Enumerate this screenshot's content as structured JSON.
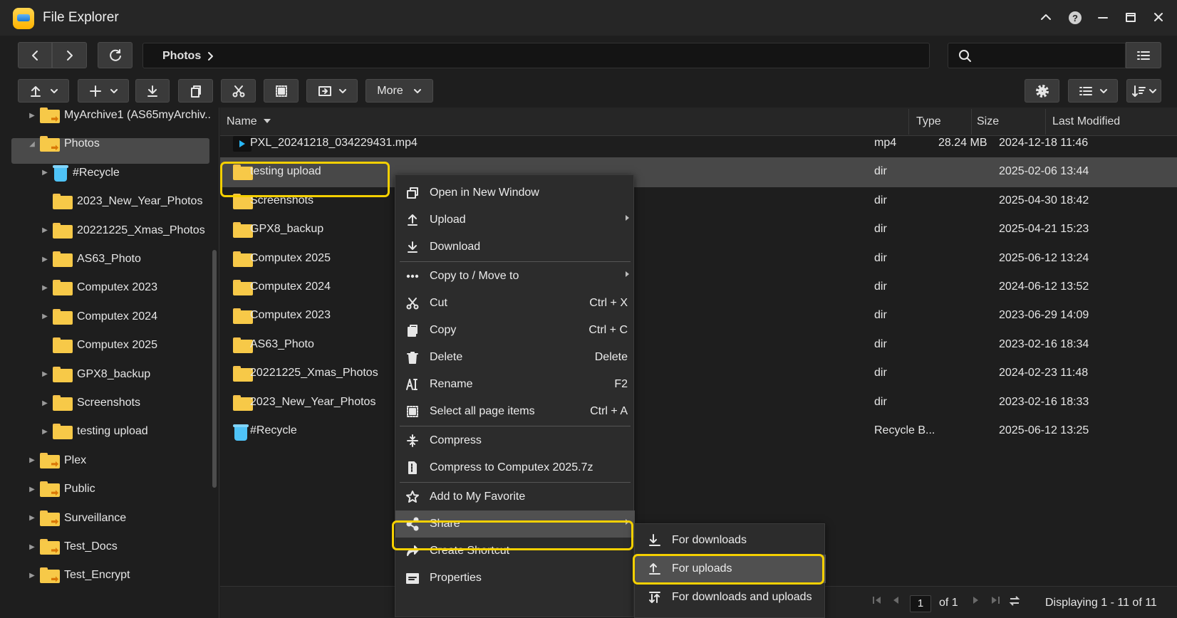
{
  "window": {
    "title": "File Explorer"
  },
  "toolbar": {
    "path": "Photos",
    "more_label": "More",
    "search_placeholder": ""
  },
  "sidebar": {
    "items": [
      {
        "label": "MyArchive1 (AS65myArchiv..",
        "icon": "share-folder-icon",
        "level": 0,
        "expand": "collapsed"
      },
      {
        "label": "Photos",
        "icon": "share-folder-icon",
        "level": 0,
        "expand": "expanded",
        "selected": true
      },
      {
        "label": "#Recycle",
        "icon": "recycle-bin-icon",
        "level": 1,
        "expand": "collapsed"
      },
      {
        "label": "2023_New_Year_Photos",
        "icon": "folder-icon",
        "level": 1,
        "expand": "none"
      },
      {
        "label": "20221225_Xmas_Photos",
        "icon": "folder-icon",
        "level": 1,
        "expand": "collapsed"
      },
      {
        "label": "AS63_Photo",
        "icon": "folder-icon",
        "level": 1,
        "expand": "collapsed"
      },
      {
        "label": "Computex 2023",
        "icon": "folder-icon",
        "level": 1,
        "expand": "collapsed"
      },
      {
        "label": "Computex 2024",
        "icon": "folder-icon",
        "level": 1,
        "expand": "collapsed"
      },
      {
        "label": "Computex 2025",
        "icon": "folder-icon",
        "level": 1,
        "expand": "none"
      },
      {
        "label": "GPX8_backup",
        "icon": "folder-icon",
        "level": 1,
        "expand": "collapsed"
      },
      {
        "label": "Screenshots",
        "icon": "folder-icon",
        "level": 1,
        "expand": "collapsed"
      },
      {
        "label": "testing upload",
        "icon": "folder-icon",
        "level": 1,
        "expand": "collapsed"
      },
      {
        "label": "Plex",
        "icon": "share-folder-icon",
        "level": 0,
        "expand": "collapsed"
      },
      {
        "label": "Public",
        "icon": "share-folder-icon",
        "level": 0,
        "expand": "collapsed"
      },
      {
        "label": "Surveillance",
        "icon": "share-folder-icon",
        "level": 0,
        "expand": "collapsed"
      },
      {
        "label": "Test_Docs",
        "icon": "share-folder-icon",
        "level": 0,
        "expand": "collapsed"
      },
      {
        "label": "Test_Encrypt",
        "icon": "share-folder-icon",
        "level": 0,
        "expand": "collapsed"
      }
    ]
  },
  "table": {
    "columns": [
      "Name",
      "Type",
      "Size",
      "Last Modified"
    ],
    "rows": [
      {
        "name": "PXL_20241218_034229431.mp4",
        "type": "mp4",
        "size": "28.24 MB",
        "modified": "2024-12-18 11:46",
        "icon": "video-icon"
      },
      {
        "name": "testing upload",
        "type": "dir",
        "size": "",
        "modified": "2025-02-06 13:44",
        "icon": "folder-icon",
        "selected": true
      },
      {
        "name": "Screenshots",
        "type": "dir",
        "size": "",
        "modified": "2025-04-30 18:42",
        "icon": "folder-icon"
      },
      {
        "name": "GPX8_backup",
        "type": "dir",
        "size": "",
        "modified": "2025-04-21 15:23",
        "icon": "folder-icon"
      },
      {
        "name": "Computex 2025",
        "type": "dir",
        "size": "",
        "modified": "2025-06-12 13:24",
        "icon": "folder-icon"
      },
      {
        "name": "Computex 2024",
        "type": "dir",
        "size": "",
        "modified": "2024-06-12 13:52",
        "icon": "folder-icon"
      },
      {
        "name": "Computex 2023",
        "type": "dir",
        "size": "",
        "modified": "2023-06-29 14:09",
        "icon": "folder-icon"
      },
      {
        "name": "AS63_Photo",
        "type": "dir",
        "size": "",
        "modified": "2023-02-16 18:34",
        "icon": "folder-icon"
      },
      {
        "name": "20221225_Xmas_Photos",
        "type": "dir",
        "size": "",
        "modified": "2024-02-23 11:48",
        "icon": "folder-icon"
      },
      {
        "name": "2023_New_Year_Photos",
        "type": "dir",
        "size": "",
        "modified": "2023-02-16 18:33",
        "icon": "folder-icon"
      },
      {
        "name": "#Recycle",
        "type": "Recycle B...",
        "size": "",
        "modified": "2025-06-12 13:25",
        "icon": "recycle-bin-icon"
      }
    ]
  },
  "pagination": {
    "page": "1",
    "of_label": "of 1",
    "display": "Displaying 1 - 11 of 11"
  },
  "context_menu": {
    "items": [
      {
        "label": "Open in New Window",
        "shortcut": "",
        "icon": "new-window-icon",
        "submenu": false
      },
      {
        "label": "Upload",
        "shortcut": "",
        "icon": "upload-icon",
        "submenu": true
      },
      {
        "label": "Download",
        "shortcut": "",
        "icon": "download-icon",
        "submenu": false
      },
      {
        "label": "Copy to / Move to",
        "shortcut": "",
        "icon": "more-dots-icon",
        "submenu": true
      },
      {
        "label": "Cut",
        "shortcut": "Ctrl + X",
        "icon": "scissors-icon",
        "submenu": false
      },
      {
        "label": "Copy",
        "shortcut": "Ctrl + C",
        "icon": "copy-icon",
        "submenu": false
      },
      {
        "label": "Delete",
        "shortcut": "Delete",
        "icon": "trash-icon",
        "submenu": false
      },
      {
        "label": "Rename",
        "shortcut": "F2",
        "icon": "rename-icon",
        "submenu": false
      },
      {
        "label": "Select all page items",
        "shortcut": "Ctrl + A",
        "icon": "select-all-icon",
        "submenu": false
      },
      {
        "label": "Compress",
        "shortcut": "",
        "icon": "compress-icon",
        "submenu": false
      },
      {
        "label": "Compress to Computex 2025.7z",
        "shortcut": "",
        "icon": "archive-icon",
        "submenu": false
      },
      {
        "label": "Add to My Favorite",
        "shortcut": "",
        "icon": "star-icon",
        "submenu": false
      },
      {
        "label": "Share",
        "shortcut": "",
        "icon": "share-icon",
        "submenu": true,
        "highlighted": true
      },
      {
        "label": "Create Shortcut",
        "shortcut": "",
        "icon": "shortcut-arrow-icon",
        "submenu": false
      },
      {
        "label": "Properties",
        "shortcut": "",
        "icon": "properties-icon",
        "submenu": false
      }
    ]
  },
  "share_submenu": {
    "items": [
      {
        "label": "For downloads",
        "icon": "download-link-icon"
      },
      {
        "label": "For uploads",
        "icon": "upload-link-icon",
        "highlighted": true
      },
      {
        "label": "For downloads and uploads",
        "icon": "updown-link-icon"
      }
    ]
  },
  "colors": {
    "highlight_outline": "#f5d000",
    "folder": "#f7c948",
    "selection": "#484848"
  }
}
